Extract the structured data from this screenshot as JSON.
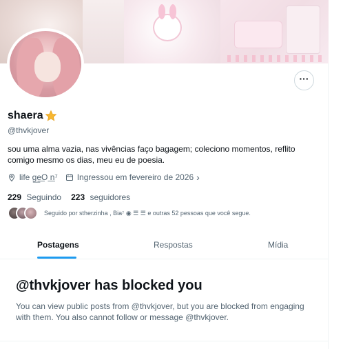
{
  "profile": {
    "display_name": "shaera",
    "badge_icon": "star-emoji",
    "handle": "@thvkjover",
    "bio": "sou uma alma vazia, nas vivências faço bagagem; coleciono momentos, reflito comigo mesmo os dias, meu eu de poesia.",
    "location": "life g͟e͟O  ͟n⁷",
    "joined": "Ingressou em fevereiro de 2026",
    "following_count": "229",
    "following_label": "Seguindo",
    "followers_count": "223",
    "followers_label": "seguidores",
    "followed_by": "Seguido por stherzinha , Bia⁷ ◉ ☰ ☰ e outras 52 pessoas que você segue."
  },
  "tabs": [
    {
      "label": "Postagens",
      "active": true
    },
    {
      "label": "Respostas",
      "active": false
    },
    {
      "label": "Mídia",
      "active": false
    }
  ],
  "blocked": {
    "title": "@thvkjover has blocked you",
    "message": "You can view public posts from @thvkjover, but you are blocked from engaging with them. You also cannot follow or message @thvkjover."
  },
  "colors": {
    "accent": "#1d9bf0",
    "text_primary": "#0f1419",
    "text_secondary": "#536471",
    "border": "#eff3f4"
  },
  "icons": {
    "more": "more-horizontal-icon",
    "location": "location-pin-icon",
    "calendar": "calendar-icon",
    "chevron": "chevron-right-icon"
  }
}
